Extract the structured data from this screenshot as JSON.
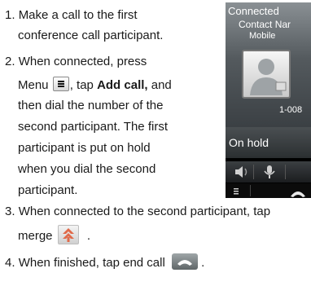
{
  "steps": [
    {
      "num": "1.",
      "lines": [
        "Make a call to the first",
        "conference call participant."
      ]
    },
    {
      "num": "2.",
      "line1": "When connected, press",
      "line2_before": "Menu",
      "line2_middle": ", tap",
      "line2_bold": "Add call,",
      "line2_after": "and",
      "lines_rest": [
        "then dial the number of the",
        "second participant. The first",
        "participant is put on hold",
        "when you dial the second",
        "participant."
      ]
    },
    {
      "num": "3.",
      "line1": "When connected to the second participant, tap",
      "line2": "merge",
      "line2_end": "."
    },
    {
      "num": "4.",
      "line1": "When finished, tap end call",
      "line1_end": "."
    }
  ],
  "phone": {
    "status": "Connected",
    "contact_name": "Contact Nar",
    "contact_type": "Mobile",
    "number": "1-008",
    "hold_label": "On hold"
  },
  "icons": {
    "menu_key": "menu-key-icon",
    "merge": "merge-icon",
    "end_call": "end-call-icon",
    "speaker": "speaker-icon",
    "mic": "microphone-icon",
    "contact": "contact-avatar-icon"
  }
}
